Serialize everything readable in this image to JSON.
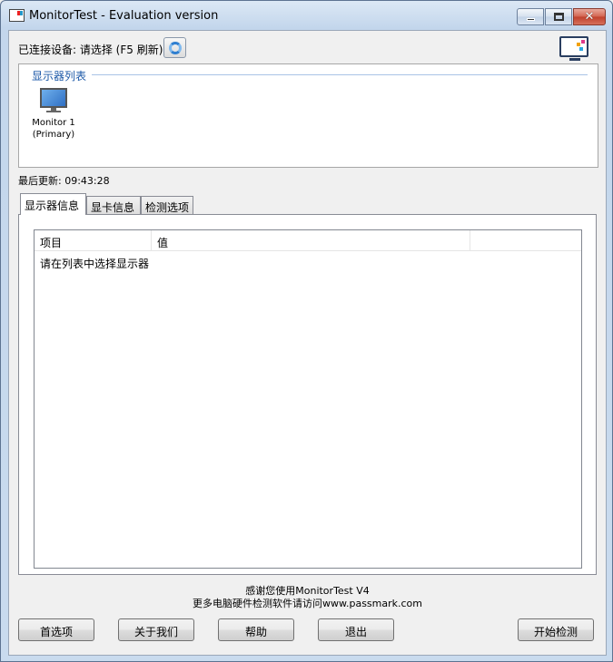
{
  "window": {
    "title": "MonitorTest - Evaluation version",
    "app_icon": "monitortest-app-icon",
    "controls": {
      "minimize_icon": "minimize-icon",
      "maximize_icon": "maximize-icon",
      "close_icon": "close-icon"
    }
  },
  "header": {
    "connected_device": "已连接设备: 请选择 (F5 刷新)",
    "refresh_icon": "refresh-icon",
    "brand_icon": "passmark-monitor-icon"
  },
  "monitor_list": {
    "group_label": "显示器列表",
    "items": [
      {
        "label_line1": "Monitor 1",
        "label_line2": "(Primary)",
        "icon": "monitor-icon"
      }
    ]
  },
  "last_update": "最后更新: 09:43:28",
  "tabs": [
    {
      "label": "显示器信息",
      "active": true
    },
    {
      "label": "显卡信息",
      "active": false
    },
    {
      "label": "检测选项",
      "active": false
    }
  ],
  "table": {
    "columns": [
      "项目",
      "值",
      ""
    ],
    "rows": [
      [
        "请在列表中选择显示器",
        ""
      ]
    ]
  },
  "footer": {
    "thanks_line1": "感谢您使用MonitorTest V4",
    "thanks_line2": "更多电脑硬件检测软件请访问www.passmark.com"
  },
  "buttons": {
    "preferences": "首选项",
    "about": "关于我们",
    "help": "帮助",
    "exit": "退出",
    "start_test": "开始检测"
  }
}
